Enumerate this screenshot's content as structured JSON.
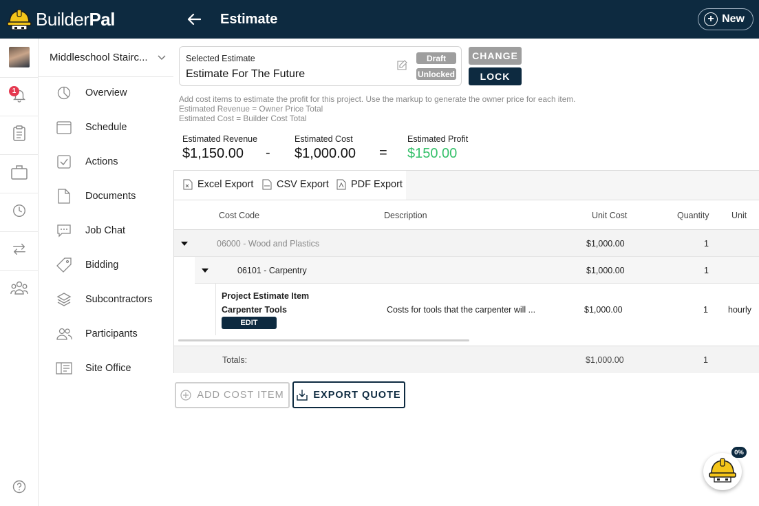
{
  "app": {
    "brand_light": "Builder",
    "brand_bold": "Pal"
  },
  "header": {
    "title": "Estimate",
    "new_label": "New"
  },
  "rail": {
    "notification_count": "1"
  },
  "project": {
    "name": "Middleschool Stairc..."
  },
  "nav": {
    "items": [
      {
        "label": "Overview",
        "icon": "pie-chart-icon"
      },
      {
        "label": "Schedule",
        "icon": "calendar-icon"
      },
      {
        "label": "Actions",
        "icon": "checkbox-icon"
      },
      {
        "label": "Documents",
        "icon": "document-icon"
      },
      {
        "label": "Job Chat",
        "icon": "chat-icon"
      },
      {
        "label": "Bidding",
        "icon": "tag-icon"
      },
      {
        "label": "Subcontractors",
        "icon": "layers-icon"
      },
      {
        "label": "Participants",
        "icon": "people-icon"
      },
      {
        "label": "Site Office",
        "icon": "site-office-icon"
      }
    ]
  },
  "estimate": {
    "label": "Selected Estimate",
    "name": "Estimate For The Future",
    "draft_label": "Draft",
    "unlocked_label": "Unlocked",
    "change_label": "CHANGE",
    "lock_label": "LOCK"
  },
  "help_text": {
    "line1": "Add cost items to estimate the profit for this project. Use the markup to generate the owner price for each item.",
    "line2": "Estimated Revenue = Owner Price Total",
    "line3": "Estimated Cost = Builder Cost Total"
  },
  "summary": {
    "revenue_label": "Estimated Revenue",
    "revenue": "$1,150.00",
    "minus": "-",
    "cost_label": "Estimated Cost",
    "cost": "$1,000.00",
    "equals": "=",
    "profit_label": "Estimated Profit",
    "profit": "$150.00",
    "profit_color": "#35c06a"
  },
  "toolbar": {
    "excel": "Excel Export",
    "csv": "CSV Export",
    "pdf": "PDF Export"
  },
  "table": {
    "headers": {
      "cost_code": "Cost Code",
      "description": "Description",
      "unit_cost": "Unit Cost",
      "quantity": "Quantity",
      "unit": "Unit"
    },
    "group1": {
      "label": "06000 - Wood and Plastics",
      "unit_cost": "$1,000.00",
      "quantity": "1"
    },
    "group2": {
      "label": "06101 - Carpentry",
      "unit_cost": "$1,000.00",
      "quantity": "1"
    },
    "item": {
      "title": "Project Estimate Item",
      "name": "Carpenter Tools",
      "edit_label": "EDIT",
      "description": "Costs for tools that the carpenter will ...",
      "unit_cost": "$1,000.00",
      "quantity": "1",
      "unit": "hourly"
    },
    "totals": {
      "label": "Totals:",
      "unit_cost": "$1,000.00",
      "quantity": "1"
    }
  },
  "actions": {
    "add_label": "ADD COST ITEM",
    "export_label": "EXPORT QUOTE"
  },
  "assistant": {
    "progress": "0%"
  }
}
